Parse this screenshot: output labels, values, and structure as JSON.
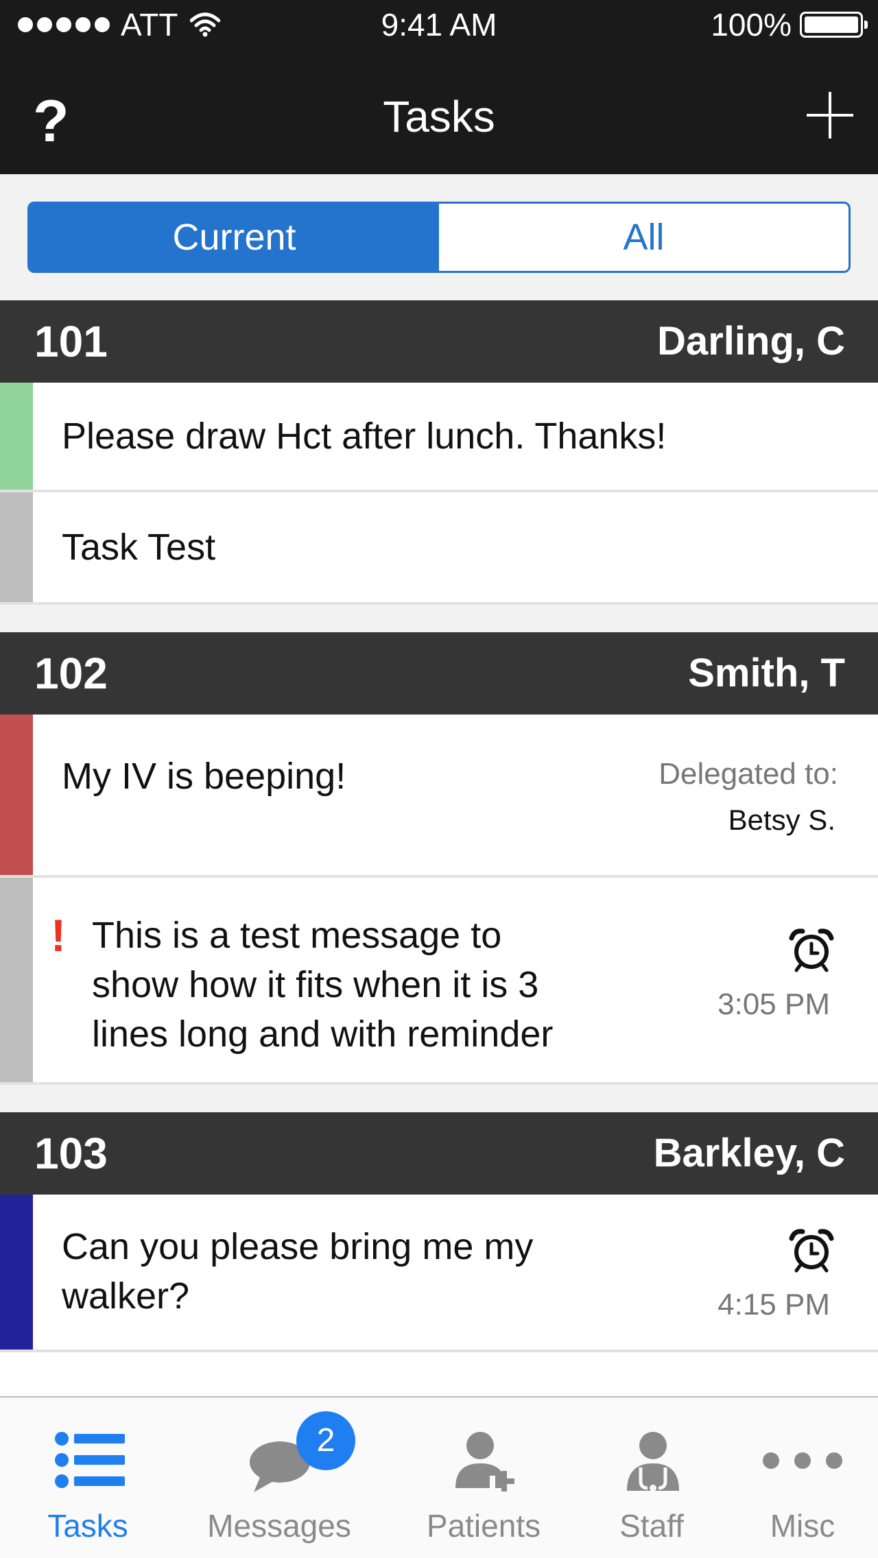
{
  "status_bar": {
    "carrier": "ATT",
    "time": "9:41 AM",
    "battery": "100%"
  },
  "nav": {
    "help": "?",
    "title": "Tasks"
  },
  "segment": {
    "current": "Current",
    "all": "All",
    "selected": "Current"
  },
  "groups": [
    {
      "room": "101",
      "patient": "Darling, C",
      "tasks": [
        {
          "text": "Please draw Hct after lunch. Thanks!",
          "color": "#90d49c"
        },
        {
          "text": "Task Test",
          "color": "#bdbdbd"
        }
      ]
    },
    {
      "room": "102",
      "patient": "Smith, T",
      "tasks": [
        {
          "text": "My IV is beeping!",
          "color": "#c25050",
          "delegated_label": "Delegated to:",
          "delegated_name": "Betsy S."
        },
        {
          "text_lines": [
            "This is a test message to",
            "show how it fits when it is 3",
            "lines long and with reminder"
          ],
          "color": "#bdbdbd",
          "priority": "!",
          "reminder_icon": "alarm-clock-icon",
          "reminder_time": "3:05 PM"
        }
      ]
    },
    {
      "room": "103",
      "patient": "Barkley, C",
      "tasks": [
        {
          "text_lines": [
            "Can you please bring me my",
            "walker?"
          ],
          "color": "#22229a",
          "reminder_icon": "alarm-clock-icon",
          "reminder_time": "4:15 PM"
        }
      ]
    }
  ],
  "tabs": [
    {
      "label": "Tasks",
      "icon": "list-icon",
      "active": true
    },
    {
      "label": "Messages",
      "icon": "chat-bubbles-icon",
      "badge": "2"
    },
    {
      "label": "Patients",
      "icon": "patient-add-icon"
    },
    {
      "label": "Staff",
      "icon": "staff-stethoscope-icon"
    },
    {
      "label": "Misc",
      "icon": "more-dots-icon"
    }
  ],
  "colors": {
    "accent": "#2473cc",
    "tab_active": "#1f7ff0",
    "header_dark": "#353535",
    "priority": "#ee3322"
  }
}
